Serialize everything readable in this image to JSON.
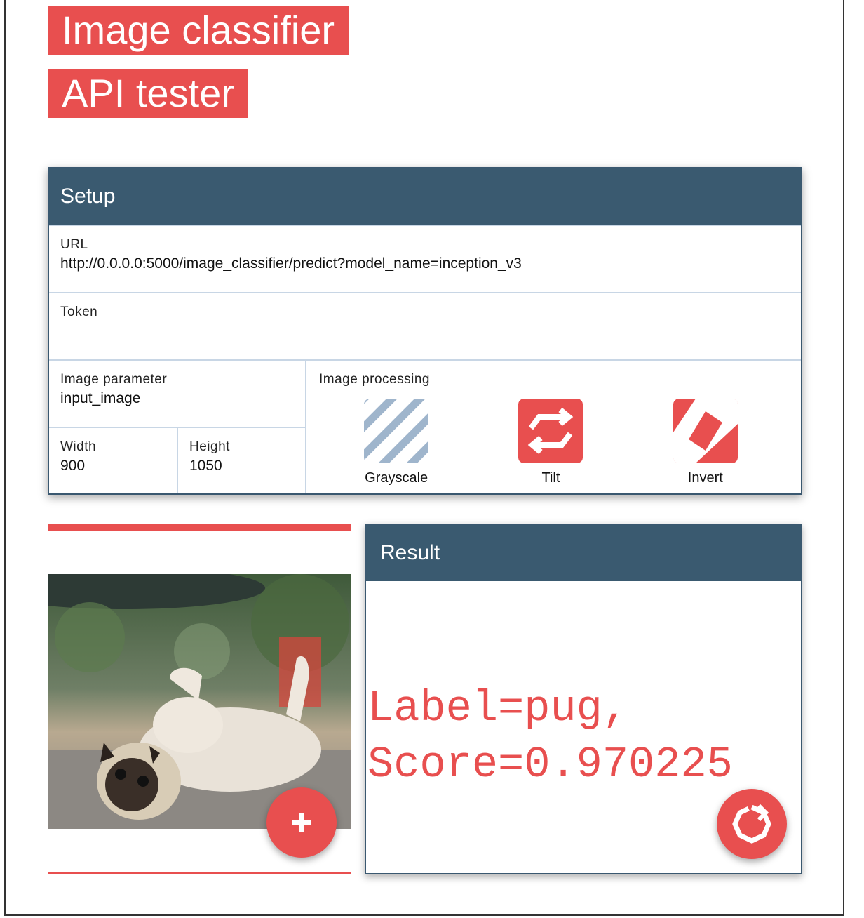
{
  "header": {
    "title_line1": "Image classifier",
    "title_line2": "API tester"
  },
  "setup": {
    "title": "Setup",
    "url_label": "URL",
    "url_value": "http://0.0.0.0:5000/image_classifier/predict?model_name=inception_v3",
    "token_label": "Token",
    "token_value": "",
    "image_param_label": "Image parameter",
    "image_param_value": "input_image",
    "width_label": "Width",
    "width_value": "900",
    "height_label": "Height",
    "height_value": "1050",
    "processing_label": "Image processing",
    "processing_items": [
      {
        "label": "Grayscale",
        "icon": "striped-icon"
      },
      {
        "label": "Tilt",
        "icon": "swap-arrows-icon"
      },
      {
        "label": "Invert",
        "icon": "invert-diamond-icon"
      }
    ]
  },
  "image_panel": {
    "image": "pug lying on its back",
    "add_icon": "plus-icon"
  },
  "result": {
    "title": "Result",
    "line1": "Label=pug,",
    "line2": "Score=0.970225",
    "refresh_icon": "refresh-icon"
  },
  "colors": {
    "accent": "#e84f4f",
    "header_bg": "#3a5a70",
    "divider": "#c8d6e5",
    "stripe": "#9fb5cc"
  }
}
